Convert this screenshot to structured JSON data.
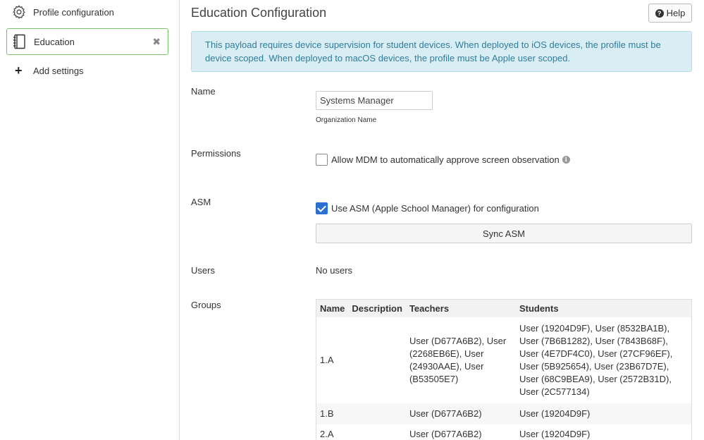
{
  "sidebar": {
    "items": [
      {
        "label": "Profile configuration",
        "icon": "gear-icon"
      },
      {
        "label": "Education",
        "icon": "notebook-icon",
        "close": "✖"
      },
      {
        "label": "Add settings",
        "icon": "plus-icon",
        "glyph": "+"
      }
    ]
  },
  "header": {
    "title": "Education Configuration",
    "help_label": "Help",
    "help_glyph": "?"
  },
  "alert": {
    "text": "This payload requires device supervision for student devices. When deployed to iOS devices, the profile must be device scoped. When deployed to macOS devices, the profile must be Apple user scoped."
  },
  "fields": {
    "name": {
      "label": "Name",
      "value": "Systems Manager",
      "sublabel": "Organization Name"
    },
    "permissions": {
      "label": "Permissions",
      "checkbox_label": "Allow MDM to automatically approve screen observation",
      "checked": false,
      "info_glyph": "i"
    },
    "asm": {
      "label": "ASM",
      "checkbox_label": "Use ASM (Apple School Manager) for configuration",
      "checked": true,
      "sync_label": "Sync ASM"
    },
    "users": {
      "label": "Users",
      "value": "No users"
    },
    "groups": {
      "label": "Groups"
    }
  },
  "groups_table": {
    "headers": [
      "Name",
      "Description",
      "Teachers",
      "Students"
    ],
    "rows": [
      {
        "name": "1.A",
        "description": "",
        "teachers": "User (D677A6B2), User (2268EB6E), User (24930AAE), User (B53505E7)",
        "students": "User (19204D9F), User (8532BA1B), User (7B6B1282), User (7843B68F), User (4E7DF4C0), User (27CF96EF), User (5B925654), User (23B67D7E), User (68C9BEA9), User (2572B31D), User (2C577134)"
      },
      {
        "name": "1.B",
        "description": "",
        "teachers": "User (D677A6B2)",
        "students": "User (19204D9F)"
      },
      {
        "name": "2.A",
        "description": "",
        "teachers": "User (D677A6B2)",
        "students": "User (19204D9F)"
      }
    ]
  },
  "colors": {
    "accent_green": "#7ec26e",
    "alert_bg": "#d9edf4",
    "alert_text": "#2f7d9b",
    "checkbox_blue": "#2b6fd0"
  }
}
